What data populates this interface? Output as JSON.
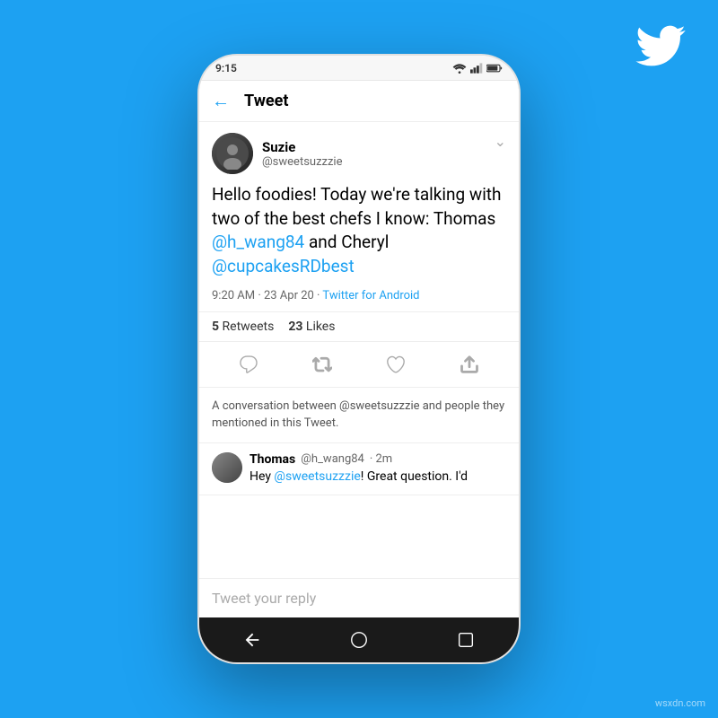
{
  "background_color": "#1da1f2",
  "twitter_logo": "twitter-bird",
  "watermark": "wsxdn.com",
  "phone": {
    "status_bar": {
      "time": "9:15"
    },
    "header": {
      "back_label": "←",
      "title": "Tweet"
    },
    "tweet": {
      "user": {
        "display_name": "Suzie",
        "handle": "@sweetsuzzzie"
      },
      "text_parts": [
        {
          "type": "text",
          "value": "Hello foodies! Today we're talking with two of the best chefs I know: Thomas "
        },
        {
          "type": "mention",
          "value": "@h_wang84"
        },
        {
          "type": "text",
          "value": " and Cheryl "
        },
        {
          "type": "mention",
          "value": "@cupcakesRDbest"
        }
      ],
      "meta": {
        "time": "9:20 AM",
        "date": "23 Apr 20",
        "via": "Twitter for Android"
      },
      "counts": {
        "retweets": "5",
        "retweets_label": "Retweets",
        "likes": "23",
        "likes_label": "Likes"
      }
    },
    "conversation_notice": "A conversation between @sweetsuzzzie and people they mentioned in this Tweet.",
    "reply": {
      "user": {
        "display_name": "Thomas",
        "handle": "@h_wang84",
        "time": "2m"
      },
      "text_before": "Hey ",
      "mention": "@sweetsuzzzie",
      "text_after": "! Great question. I'd"
    },
    "reply_input": {
      "placeholder": "Tweet your reply"
    }
  }
}
